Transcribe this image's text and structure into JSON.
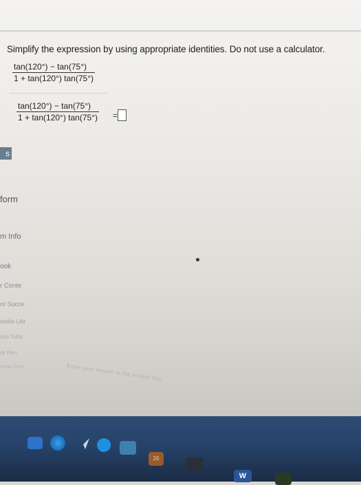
{
  "question": {
    "text": "Simplify the expression by using appropriate identities. Do not use a calculator."
  },
  "expression": {
    "numerator": "tan(120°) − tan(75°)",
    "denominator": "1 + tan(120°) tan(75°)"
  },
  "answer_row": {
    "numerator": "tan(120°) − tan(75°)",
    "denominator": "1 + tan(120°) tan(75°)",
    "equals": "=",
    "answer_value": ""
  },
  "sidebar": {
    "tab_label": "s",
    "items": [
      {
        "label": "form"
      },
      {
        "label": "m Info"
      },
      {
        "label": "ook"
      },
      {
        "label": "r Conte"
      },
      {
        "label": "or Succe"
      },
      {
        "label": "nedia Libr"
      },
      {
        "label": "son Tutor"
      },
      {
        "label": "dy Plan"
      },
      {
        "label": "ourse Tools"
      }
    ]
  },
  "hint": {
    "text": "Enter your answer in the answer box"
  },
  "taskbar": {
    "items": [
      {
        "icon": "task-view-icon"
      },
      {
        "icon": "edge-browser-icon"
      },
      {
        "icon": "send-icon"
      },
      {
        "icon": "app-icon"
      },
      {
        "icon": "chat-icon"
      },
      {
        "icon": "calendar-icon",
        "label": "26"
      },
      {
        "icon": "media-icon"
      },
      {
        "icon": "word-icon",
        "label": "W"
      },
      {
        "icon": "app-icon-green"
      }
    ]
  },
  "colors": {
    "taskbar": "#26436a",
    "sidebar_tab": "#6a7d90",
    "content_bg": "#f4f3f1"
  }
}
